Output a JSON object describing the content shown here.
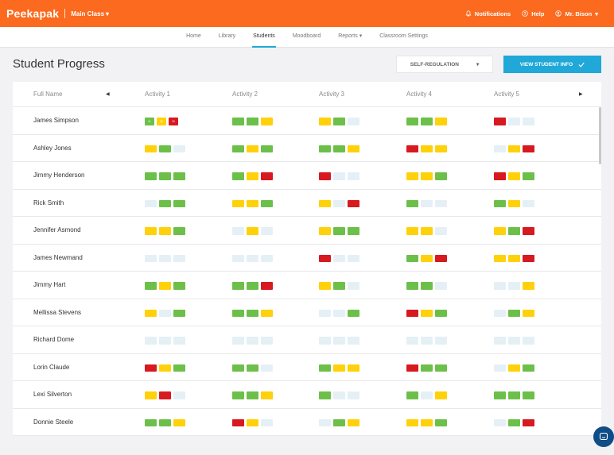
{
  "app": {
    "logo": "Peekapak",
    "class_name": "Main Class"
  },
  "topbar": {
    "notifications": "Notifications",
    "help": "Help",
    "user": "Mr. Bison"
  },
  "nav": [
    "Home",
    "Library",
    "Students",
    "Moodboard",
    "Reports",
    "Classroom Settings"
  ],
  "page_title": "Student Progress",
  "dropdown": {
    "value": "SELF-REGULATION"
  },
  "view_button": "VIEW STUDENT INFO",
  "colors": {
    "brand": "#fb6a1f",
    "accent": "#1fa8d8",
    "green": "#6cc04a",
    "yellow": "#ffd10a",
    "red": "#d71920",
    "empty": "#e5f0f6"
  },
  "table": {
    "name_header": "Full Name",
    "activity_headers": [
      "Activity 1",
      "Activity 2",
      "Activity 3",
      "Activity 4",
      "Activity 5"
    ],
    "first_row_labels": [
      "i1",
      "i2",
      "i3"
    ],
    "rows": [
      {
        "name": "James Simpson",
        "acts": [
          [
            "g",
            "y",
            "r"
          ],
          [
            "g",
            "g",
            "y"
          ],
          [
            "y",
            "g",
            "e"
          ],
          [
            "g",
            "g",
            "y"
          ],
          [
            "r",
            "e",
            "e"
          ]
        ]
      },
      {
        "name": "Ashley Jones",
        "acts": [
          [
            "y",
            "g",
            "e"
          ],
          [
            "g",
            "y",
            "g"
          ],
          [
            "g",
            "g",
            "y"
          ],
          [
            "r",
            "y",
            "y"
          ],
          [
            "e",
            "y",
            "r"
          ]
        ]
      },
      {
        "name": "Jimmy Henderson",
        "acts": [
          [
            "g",
            "g",
            "g"
          ],
          [
            "g",
            "y",
            "r"
          ],
          [
            "r",
            "e",
            "e"
          ],
          [
            "y",
            "y",
            "g"
          ],
          [
            "r",
            "y",
            "g"
          ]
        ]
      },
      {
        "name": "Rick Smith",
        "acts": [
          [
            "e",
            "g",
            "g"
          ],
          [
            "y",
            "y",
            "g"
          ],
          [
            "y",
            "e",
            "r"
          ],
          [
            "g",
            "e",
            "e"
          ],
          [
            "g",
            "y",
            "e"
          ]
        ]
      },
      {
        "name": "Jennifer Asmond",
        "acts": [
          [
            "y",
            "y",
            "g"
          ],
          [
            "e",
            "y",
            "e"
          ],
          [
            "y",
            "g",
            "g"
          ],
          [
            "y",
            "y",
            "e"
          ],
          [
            "y",
            "g",
            "r"
          ]
        ]
      },
      {
        "name": "James Newmand",
        "acts": [
          [
            "e",
            "e",
            "e"
          ],
          [
            "e",
            "e",
            "e"
          ],
          [
            "r",
            "e",
            "e"
          ],
          [
            "g",
            "y",
            "r"
          ],
          [
            "y",
            "y",
            "r"
          ]
        ]
      },
      {
        "name": "Jimmy Hart",
        "acts": [
          [
            "g",
            "y",
            "g"
          ],
          [
            "g",
            "g",
            "r"
          ],
          [
            "y",
            "g",
            "e"
          ],
          [
            "g",
            "g",
            "e"
          ],
          [
            "e",
            "e",
            "y"
          ]
        ]
      },
      {
        "name": "Mellissa Stevens",
        "acts": [
          [
            "y",
            "e",
            "g"
          ],
          [
            "g",
            "g",
            "y"
          ],
          [
            "e",
            "e",
            "g"
          ],
          [
            "r",
            "y",
            "g"
          ],
          [
            "e",
            "g",
            "y"
          ]
        ]
      },
      {
        "name": "Richard Dome",
        "acts": [
          [
            "e",
            "e",
            "e"
          ],
          [
            "e",
            "e",
            "e"
          ],
          [
            "e",
            "e",
            "e"
          ],
          [
            "e",
            "e",
            "e"
          ],
          [
            "e",
            "e",
            "e"
          ]
        ]
      },
      {
        "name": "Lorin Claude",
        "acts": [
          [
            "r",
            "y",
            "g"
          ],
          [
            "g",
            "g",
            "e"
          ],
          [
            "g",
            "y",
            "y"
          ],
          [
            "r",
            "g",
            "g"
          ],
          [
            "e",
            "y",
            "g"
          ]
        ]
      },
      {
        "name": "Lexi Silverton",
        "acts": [
          [
            "y",
            "r",
            "e"
          ],
          [
            "g",
            "g",
            "y"
          ],
          [
            "g",
            "e",
            "e"
          ],
          [
            "g",
            "e",
            "y"
          ],
          [
            "g",
            "g",
            "g"
          ]
        ]
      },
      {
        "name": "Donnie Steele",
        "acts": [
          [
            "g",
            "g",
            "y"
          ],
          [
            "r",
            "y",
            "e"
          ],
          [
            "e",
            "g",
            "y"
          ],
          [
            "y",
            "y",
            "g"
          ],
          [
            "e",
            "g",
            "r"
          ]
        ]
      }
    ]
  }
}
